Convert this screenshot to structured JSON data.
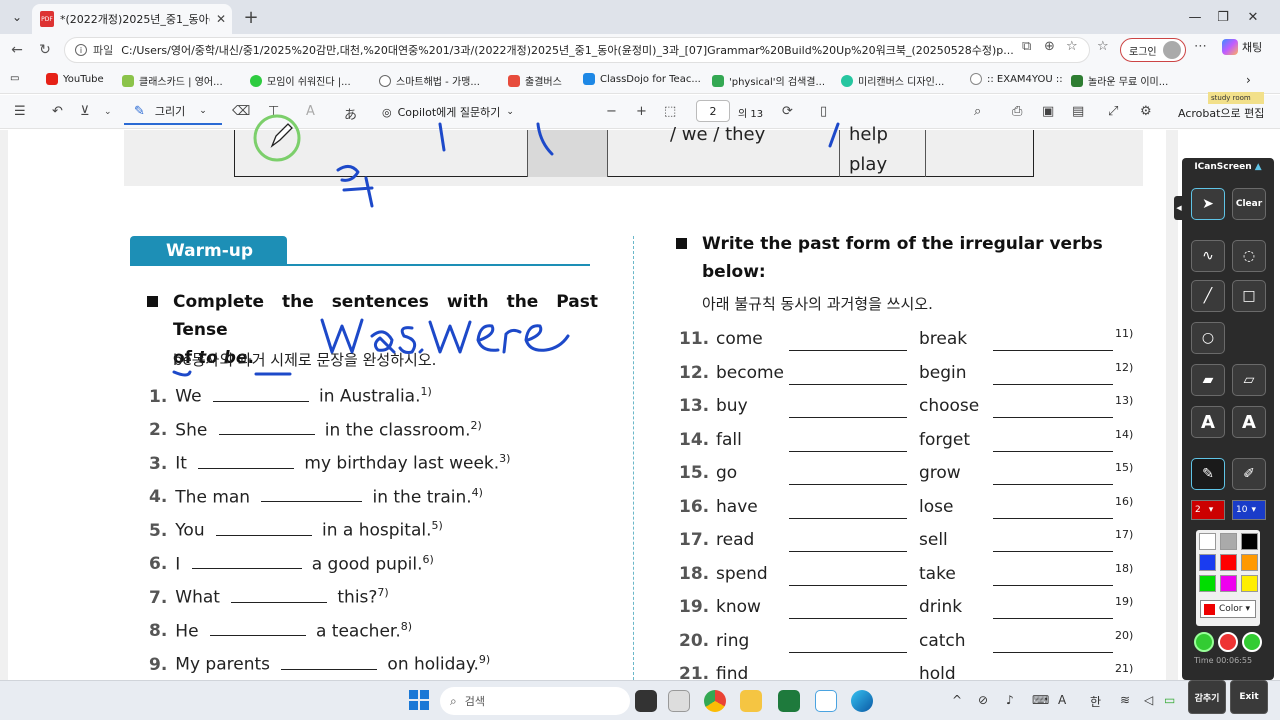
{
  "browser": {
    "tab_title": "*(2022개정)2025년_중1_동아(윤정",
    "url_label": "파일",
    "url": "C:/Users/영어/중학/내신/중1/2025%20감만,대천,%20대연중%201/3과/(2022개정)2025년_중1_동아(윤정미)_3과_[07]Grammar%20Build%20Up%20워크북_(20250528수정)p...",
    "login_label": "로그인",
    "chat_label": "채팅",
    "bookmarks": [
      {
        "label": "YouTube",
        "color": "#e62117"
      },
      {
        "label": "클래스카드 | 영어...",
        "color": "#8bc34a"
      },
      {
        "label": "모임이 쉬워진다 |...",
        "color": "#2ecc40"
      },
      {
        "label": "스마트해법 - 가맹...",
        "color": "#666666"
      },
      {
        "label": "출결버스",
        "color": "#e74c3c"
      },
      {
        "label": "ClassDojo for Teac...",
        "color": "#1e88e5"
      },
      {
        "label": "'physical'의 검색결...",
        "color": "#34a853"
      },
      {
        "label": "미리캔버스 디자인...",
        "color": "#26c6a0"
      },
      {
        "label": ":: EXAM4YOU ::",
        "color": "#888888"
      },
      {
        "label": "놀라운 무료 이미...",
        "color": "#2e7d32"
      }
    ],
    "study_room": "study room"
  },
  "pdf_toolbar": {
    "draw_label": "그리기",
    "copilot_label": "Copilot에게 질문하기",
    "page_current": "2",
    "page_total": "의 13",
    "acrobat_label": "Acrobat으로 편집"
  },
  "document": {
    "prev_we": "/ we / they",
    "prev_help": "help",
    "prev_play": "play",
    "warmup_tab": "Warm-up",
    "left_heading_line1": "Complete the sentences with the Past Tense",
    "left_heading_of": "of ",
    "left_heading_tobe": "to be",
    "left_heading_end": ".",
    "left_sub": "be동사의 과거 시제로 문장을 완성하시오.",
    "exercises": [
      {
        "num": "1.",
        "pre": "We",
        "post": "in Australia.",
        "fn": "1)"
      },
      {
        "num": "2.",
        "pre": "She",
        "post": "in the classroom.",
        "fn": "2)"
      },
      {
        "num": "3.",
        "pre": "It",
        "post": "my birthday last week.",
        "fn": "3)"
      },
      {
        "num": "4.",
        "pre": "The man",
        "post": "in the train.",
        "fn": "4)"
      },
      {
        "num": "5.",
        "pre": "You",
        "post": "in a hospital.",
        "fn": "5)"
      },
      {
        "num": "6.",
        "pre": "I",
        "post": "a good pupil.",
        "fn": "6)"
      },
      {
        "num": "7.",
        "pre": "What",
        "post": "this?",
        "fn": "7)"
      },
      {
        "num": "8.",
        "pre": "He",
        "post": "a teacher.",
        "fn": "8)"
      },
      {
        "num": "9.",
        "pre": "My parents",
        "post": "on holiday.",
        "fn": "9)"
      }
    ],
    "right_heading_line1": "Write the past form of the irregular verbs",
    "right_heading_line2": "below:",
    "right_sub": "아래 불규칙 동사의 과거형을 쓰시오.",
    "verbs": [
      {
        "num": "11.",
        "v1": "come",
        "v2": "break",
        "fn": "11)"
      },
      {
        "num": "12.",
        "v1": "become",
        "v2": "begin",
        "fn": "12)"
      },
      {
        "num": "13.",
        "v1": "buy",
        "v2": "choose",
        "fn": "13)"
      },
      {
        "num": "14.",
        "v1": "fall",
        "v2": "forget",
        "fn": "14)"
      },
      {
        "num": "15.",
        "v1": "go",
        "v2": "grow",
        "fn": "15)"
      },
      {
        "num": "16.",
        "v1": "have",
        "v2": "lose",
        "fn": "16)"
      },
      {
        "num": "17.",
        "v1": "read",
        "v2": "sell",
        "fn": "17)"
      },
      {
        "num": "18.",
        "v1": "spend",
        "v2": "take",
        "fn": "18)"
      },
      {
        "num": "19.",
        "v1": "know",
        "v2": "drink",
        "fn": "19)"
      },
      {
        "num": "20.",
        "v1": "ring",
        "v2": "catch",
        "fn": "20)"
      },
      {
        "num": "21.",
        "v1": "find",
        "v2": "hold",
        "fn": "21)"
      }
    ]
  },
  "ics_panel": {
    "title": "ICanScreen",
    "clear_label": "Clear",
    "text_label": "A",
    "size_value": "2",
    "width_value": "10",
    "color_label": "Color",
    "time_label": "Time 00:06:55",
    "hide_label": "감추기",
    "exit_label": "Exit"
  },
  "taskbar": {
    "search_placeholder": "검색",
    "ime_label": "한",
    "input_label": "A"
  }
}
